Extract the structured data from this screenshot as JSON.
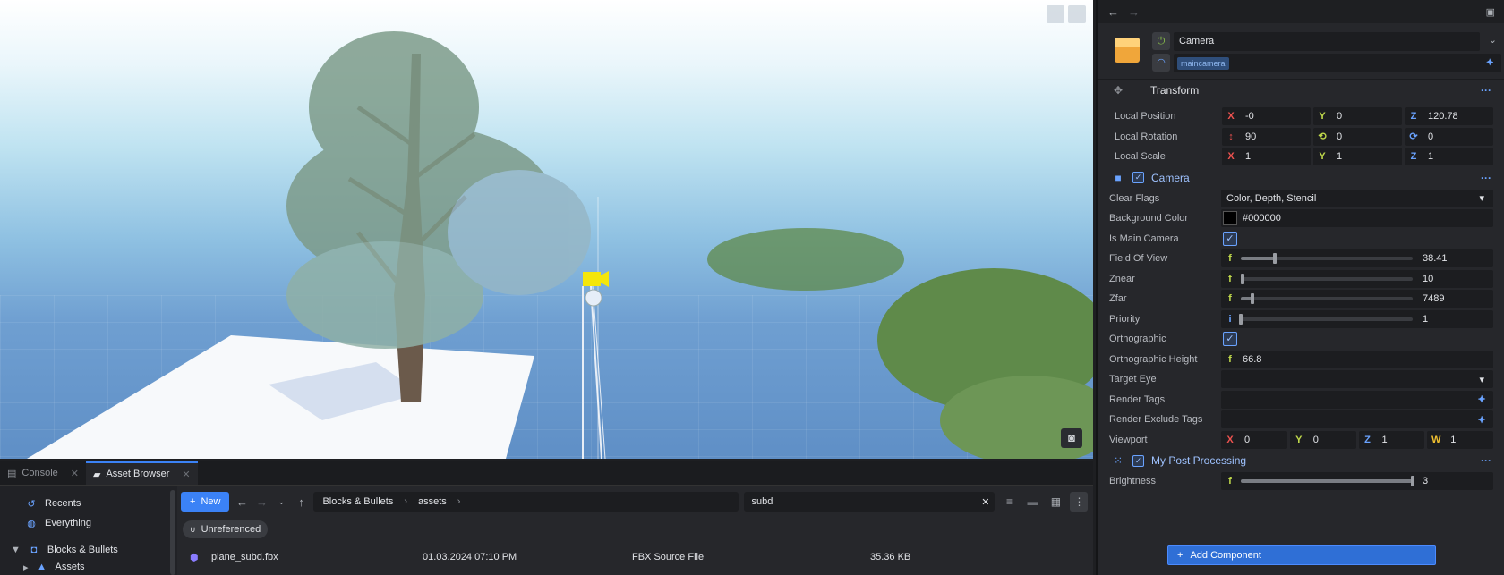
{
  "viewport": {
    "icons": [
      "view-toggle-icon-1",
      "view-toggle-icon-2",
      "camera-gizmo-icon",
      "screenshot-camera-icon"
    ]
  },
  "dock": {
    "tabs": [
      {
        "label": "Console",
        "icon": "console-icon"
      },
      {
        "label": "Asset Browser",
        "icon": "folder-icon"
      }
    ],
    "sidebar": [
      {
        "label": "Recents",
        "icon": "history-icon"
      },
      {
        "label": "Everything",
        "icon": "globe-icon"
      },
      {
        "label": "Blocks & Bullets",
        "icon": "gamepad-icon"
      },
      {
        "label": "Assets",
        "icon": "assets-icon"
      }
    ],
    "toolbar": {
      "new_label": "New",
      "crumbs": [
        "Blocks & Bullets",
        "assets"
      ],
      "search_value": "subd"
    },
    "filter_chip": "Unreferenced",
    "files": [
      {
        "name": "plane_subd.fbx",
        "date": "01.03.2024 07:10 PM",
        "type": "FBX Source File",
        "size": "35.36 KB"
      }
    ]
  },
  "inspector": {
    "name": "Camera",
    "tag": "maincamera",
    "transform": {
      "title": "Transform",
      "position_label": "Local Position",
      "position": {
        "x": "-0",
        "y": "0",
        "z": "120.78"
      },
      "rotation_label": "Local Rotation",
      "rotation": {
        "pitch": "90",
        "yaw": "0",
        "roll": "0"
      },
      "scale_label": "Local Scale",
      "scale": {
        "x": "1",
        "y": "1",
        "z": "1"
      }
    },
    "camera": {
      "title": "Camera",
      "clear_flags_label": "Clear Flags",
      "clear_flags": "Color, Depth, Stencil",
      "bg_color_label": "Background Color",
      "bg_color": "#000000",
      "is_main_label": "Is Main Camera",
      "fov_label": "Field Of View",
      "fov": "38.41",
      "fov_fraction": 0.2,
      "znear_label": "Znear",
      "znear": "10",
      "znear_fraction": 0.01,
      "zfar_label": "Zfar",
      "zfar": "7489",
      "zfar_fraction": 0.07,
      "priority_label": "Priority",
      "priority": "1",
      "priority_fraction": 0.0,
      "ortho_label": "Orthographic",
      "ortho_height_label": "Orthographic Height",
      "ortho_height": "66.8",
      "target_eye_label": "Target Eye",
      "render_tags_label": "Render Tags",
      "render_exclude_label": "Render Exclude Tags",
      "viewport_label": "Viewport",
      "viewport": {
        "x": "0",
        "y": "0",
        "z": "1",
        "w": "1"
      }
    },
    "post": {
      "title": "My Post Processing",
      "brightness_label": "Brightness",
      "brightness": "3",
      "brightness_fraction": 1.0
    },
    "add_component": "Add Component"
  },
  "type_letters": {
    "float": "f",
    "int": "i"
  },
  "colors": {
    "accent": "#3b82f6",
    "axis_x": "#ef5350",
    "axis_y": "#c0d94b",
    "axis_z": "#6aa3ff",
    "gizmo": "#f5e60a"
  }
}
